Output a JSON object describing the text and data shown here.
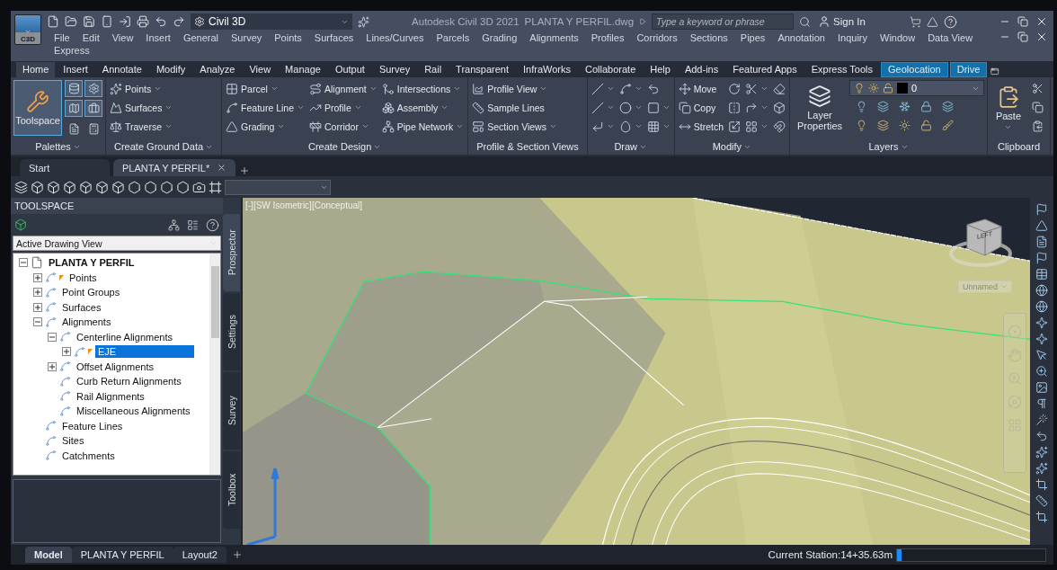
{
  "app_button": {
    "label": "C3D"
  },
  "quick_access": {
    "workspace": "Civil 3D"
  },
  "app_name": "Autodesk Civil 3D 2021",
  "file_name": "PLANTA Y PERFIL.dwg",
  "search": {
    "placeholder": "Type a keyword or phrase"
  },
  "sign_in": "Sign In",
  "menu_bar": [
    "File",
    "Edit",
    "View",
    "Insert",
    "General",
    "Survey",
    "Points",
    "Surfaces",
    "Lines/Curves",
    "Parcels",
    "Grading",
    "Alignments",
    "Profiles",
    "Corridors",
    "Sections",
    "Pipes",
    "Annotation",
    "Inquiry",
    "Window",
    "Data View",
    "Express"
  ],
  "ribbon_tabs": [
    {
      "label": "Home",
      "selected": true,
      "contextual": false
    },
    {
      "label": "Insert",
      "selected": false,
      "contextual": false
    },
    {
      "label": "Annotate",
      "selected": false,
      "contextual": false
    },
    {
      "label": "Modify",
      "selected": false,
      "contextual": false
    },
    {
      "label": "Analyze",
      "selected": false,
      "contextual": false
    },
    {
      "label": "View",
      "selected": false,
      "contextual": false
    },
    {
      "label": "Manage",
      "selected": false,
      "contextual": false
    },
    {
      "label": "Output",
      "selected": false,
      "contextual": false
    },
    {
      "label": "Survey",
      "selected": false,
      "contextual": false
    },
    {
      "label": "Rail",
      "selected": false,
      "contextual": false
    },
    {
      "label": "Transparent",
      "selected": false,
      "contextual": false
    },
    {
      "label": "InfraWorks",
      "selected": false,
      "contextual": false
    },
    {
      "label": "Collaborate",
      "selected": false,
      "contextual": false
    },
    {
      "label": "Help",
      "selected": false,
      "contextual": false
    },
    {
      "label": "Add-ins",
      "selected": false,
      "contextual": false
    },
    {
      "label": "Featured Apps",
      "selected": false,
      "contextual": false
    },
    {
      "label": "Express Tools",
      "selected": false,
      "contextual": false
    },
    {
      "label": "Geolocation",
      "selected": false,
      "contextual": true
    },
    {
      "label": "Drive",
      "selected": false,
      "contextual": true
    }
  ],
  "ribbon_panels": [
    {
      "kind": "palettes",
      "title": "Palettes",
      "menu": true,
      "big": {
        "label": "Toolspace",
        "selected": true
      }
    },
    {
      "kind": "tools",
      "title": "Create Ground Data",
      "menu": true,
      "columns": [
        [
          {
            "label": "Points",
            "dropdown": true
          },
          {
            "label": "Surfaces",
            "dropdown": true
          },
          {
            "label": "Traverse",
            "dropdown": true
          }
        ]
      ]
    },
    {
      "kind": "tools",
      "title": "Create Design",
      "menu": true,
      "columns": [
        [
          {
            "label": "Parcel",
            "dropdown": true
          },
          {
            "label": "Feature Line",
            "dropdown": true
          },
          {
            "label": "Grading",
            "dropdown": true
          }
        ],
        [
          {
            "label": "Alignment",
            "dropdown": true
          },
          {
            "label": "Profile",
            "dropdown": true
          },
          {
            "label": "Corridor",
            "dropdown": true
          }
        ],
        [
          {
            "label": "Intersections",
            "dropdown": true
          },
          {
            "label": "Assembly",
            "dropdown": true
          },
          {
            "label": "Pipe Network",
            "dropdown": true
          }
        ]
      ]
    },
    {
      "kind": "tools",
      "title": "Profile & Section Views",
      "menu": false,
      "columns": [
        [
          {
            "label": "Profile View",
            "dropdown": true
          },
          {
            "label": "Sample Lines",
            "dropdown": false
          },
          {
            "label": "Section Views",
            "dropdown": true
          }
        ]
      ]
    },
    {
      "kind": "tools",
      "title": "Draw",
      "menu": true,
      "columns": [
        [
          {
            "dropdown": true
          },
          {
            "dropdown": true
          },
          {
            "dropdown": true
          }
        ],
        [
          {
            "dropdown": true
          },
          {
            "dropdown": true
          },
          {
            "dropdown": true
          }
        ],
        [
          {
            "dropdown": false
          },
          {
            "dropdown": true
          },
          {
            "dropdown": true
          }
        ]
      ]
    },
    {
      "kind": "tools",
      "title": "Modify",
      "menu": true,
      "columns": [
        [
          {
            "label": "Move",
            "dropdown": false
          },
          {
            "label": "Copy",
            "dropdown": false
          },
          {
            "label": "Stretch",
            "dropdown": false
          }
        ],
        [
          {
            "dropdown": false
          },
          {
            "dropdown": false
          },
          {
            "dropdown": false
          }
        ],
        [
          {
            "dropdown": true
          },
          {
            "dropdown": true
          },
          {
            "dropdown": true
          }
        ],
        [
          {
            "dropdown": false
          },
          {
            "dropdown": false
          },
          {
            "dropdown": false
          }
        ]
      ]
    },
    {
      "kind": "layers",
      "title": "Layers",
      "menu": true,
      "big": {
        "label": "Layer Properties"
      },
      "current_layer": {
        "name": "0",
        "color": "#000000"
      }
    },
    {
      "kind": "clipboard",
      "title": "Clipboard",
      "menu": false,
      "big": {
        "label": "Paste",
        "dropdown": true
      }
    }
  ],
  "document_tabs": [
    {
      "label": "Start",
      "selected": false
    },
    {
      "label": "PLANTA Y PERFIL*",
      "selected": true
    }
  ],
  "toolspace": {
    "title": "TOOLSPACE",
    "view": "Active Drawing View",
    "tree": [
      {
        "label": "PLANTA Y PERFIL",
        "expanded": true,
        "selected": false,
        "flagged": false,
        "children": [
          {
            "label": "Points",
            "expanded": false,
            "selected": false,
            "flagged": true
          },
          {
            "label": "Point Groups",
            "expanded": false,
            "selected": false,
            "flagged": false
          },
          {
            "label": "Surfaces",
            "expanded": false,
            "selected": false,
            "flagged": false
          },
          {
            "label": "Alignments",
            "expanded": true,
            "selected": false,
            "flagged": false,
            "children": [
              {
                "label": "Centerline Alignments",
                "expanded": true,
                "selected": false,
                "flagged": false,
                "children": [
                  {
                    "label": "EJE",
                    "expanded": false,
                    "selected": true,
                    "flagged": true
                  }
                ]
              },
              {
                "label": "Offset Alignments",
                "expanded": false,
                "selected": false,
                "flagged": false
              },
              {
                "label": "Curb Return Alignments",
                "selected": false,
                "flagged": false
              },
              {
                "label": "Rail Alignments",
                "selected": false,
                "flagged": false
              },
              {
                "label": "Miscellaneous Alignments",
                "selected": false,
                "flagged": false
              }
            ]
          },
          {
            "label": "Feature Lines",
            "selected": false,
            "flagged": false
          },
          {
            "label": "Sites",
            "selected": false,
            "flagged": false
          },
          {
            "label": "Catchments",
            "selected": false,
            "flagged": false
          }
        ]
      }
    ],
    "side_tabs": [
      {
        "label": "Prospector",
        "selected": true
      },
      {
        "label": "Settings",
        "selected": false
      },
      {
        "label": "Survey",
        "selected": false
      },
      {
        "label": "Toolbox",
        "selected": false
      }
    ]
  },
  "viewport": {
    "label": "[-][SW Isometric][Conceptual]",
    "viewcube_face": "LEFT",
    "view_name": "Unnamed"
  },
  "layout_tabs": [
    {
      "label": "Model",
      "selected": true
    },
    {
      "label": "PLANTA Y PERFIL",
      "selected": false
    },
    {
      "label": "Layout2",
      "selected": false
    }
  ],
  "status": {
    "station": "Current Station:14+35.63m",
    "level": 0.03
  }
}
